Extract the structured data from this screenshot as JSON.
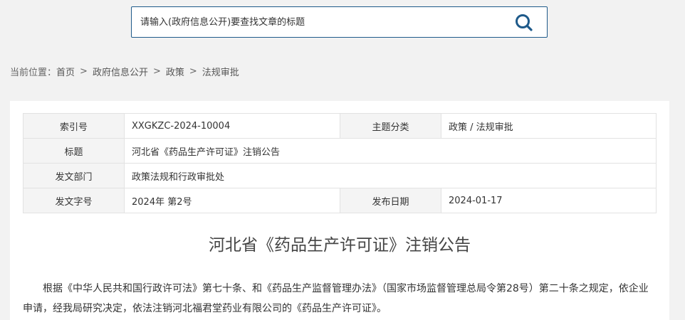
{
  "search": {
    "placeholder": "请输入(政府信息公开)要查找文章的标题",
    "icon": "search-icon",
    "accent_color": "#1e5a8a"
  },
  "breadcrumb": {
    "prefix": "当前位置：",
    "items": [
      "首页",
      "政府信息公开",
      "政策",
      "法规审批"
    ],
    "separator": ">"
  },
  "meta": {
    "index_label": "索引号",
    "index_value": "XXGKZC-2024-10004",
    "topic_label": "主题分类",
    "topic_value": "政策 / 法规审批",
    "title_label": "标题",
    "title_value": "河北省《药品生产许可证》注销公告",
    "dept_label": "发文部门",
    "dept_value": "政策法规和行政审批处",
    "docno_label": "发文字号",
    "docno_value": "2024年 第2号",
    "date_label": "发布日期",
    "date_value": "2024-01-17"
  },
  "article": {
    "title": "河北省《药品生产许可证》注销公告",
    "body": "根据《中华人民共和国行政许可法》第七十条、和《药品生产监督管理办法》（国家市场监督管理总局令第28号）第二十条之规定，依企业申请，经我局研究决定，依法注销河北福君堂药业有限公司的《药品生产许可证》。"
  }
}
